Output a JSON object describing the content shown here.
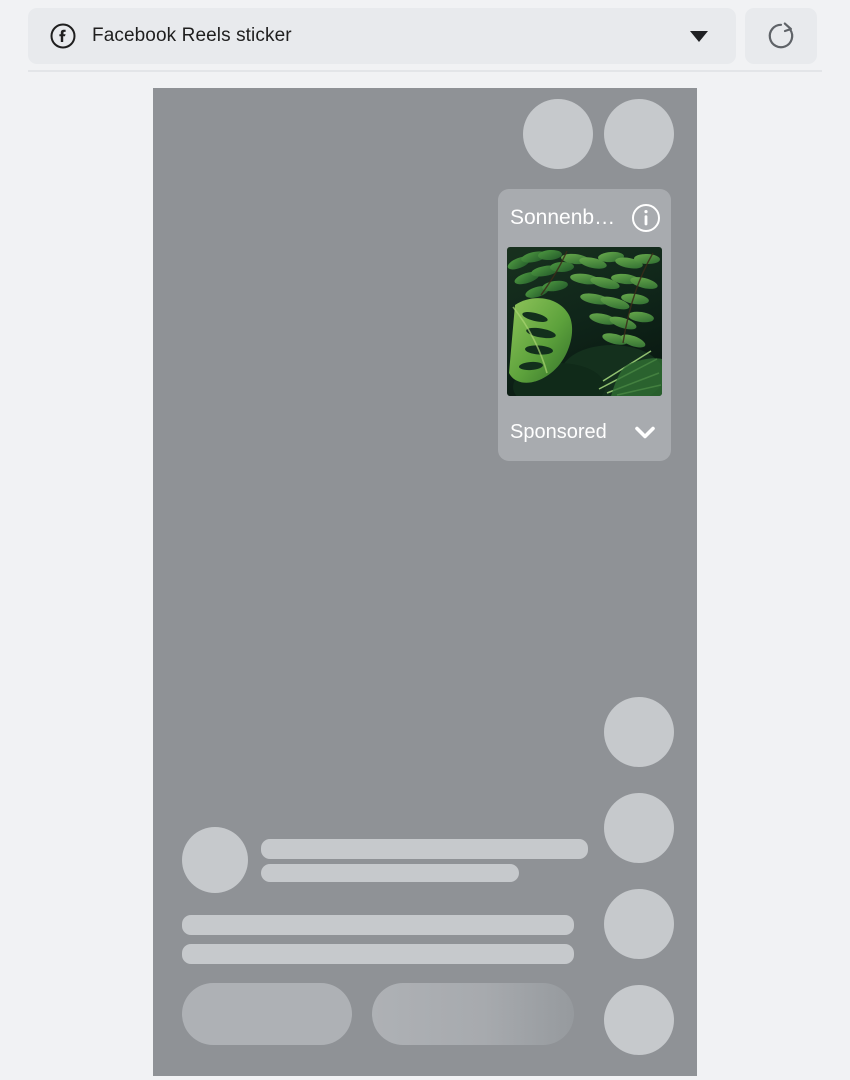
{
  "toolbar": {
    "sticker_select": {
      "icon": "facebook-icon",
      "label": "Facebook Reels sticker",
      "caret_icon": "chevron-down-icon"
    },
    "refresh_button": {
      "icon": "refresh-icon",
      "label": ""
    }
  },
  "preview": {
    "frame": {
      "background_color": "#8f9296",
      "placeholder_color": "#c6c9cc",
      "pill_color": "#aeb1b5"
    },
    "top_circles": [
      {
        "name": "top-circle-1"
      },
      {
        "name": "top-circle-2"
      }
    ],
    "side_circles": [
      {
        "name": "side-circle-1"
      },
      {
        "name": "side-circle-2"
      },
      {
        "name": "side-circle-3"
      },
      {
        "name": "side-circle-4"
      }
    ],
    "caption_block": {
      "avatar": "avatar-placeholder",
      "bars": [
        {
          "name": "caption-bar-1"
        },
        {
          "name": "caption-bar-2"
        },
        {
          "name": "caption-bar-3"
        },
        {
          "name": "caption-bar-4"
        }
      ]
    },
    "action_pills": [
      {
        "name": "action-pill-left"
      },
      {
        "name": "action-pill-right"
      }
    ]
  },
  "sticker_card": {
    "title": "Sonnenb…",
    "info_icon": "info-icon",
    "image_alt": "tropical-foliage-photo",
    "sponsored_label": "Sponsored",
    "chevron_icon": "chevron-down-icon",
    "background_color": "#a8abaf",
    "text_color": "#ffffff"
  }
}
